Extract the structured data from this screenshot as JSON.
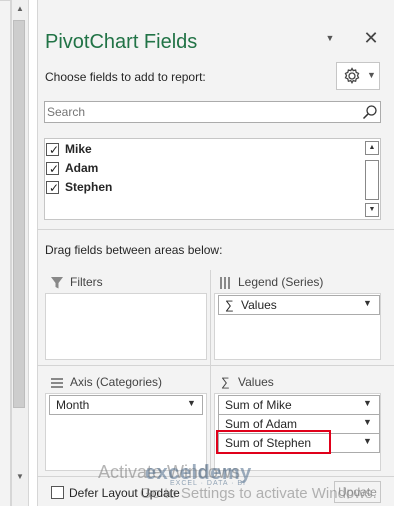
{
  "pane": {
    "title": "PivotChart Fields",
    "choose_label": "Choose fields to add to report:",
    "search_placeholder": "Search",
    "drag_label": "Drag fields between areas below:",
    "defer_label": "Defer Layout Update",
    "update_label": "Update",
    "title_color": "#217346"
  },
  "fields": [
    {
      "label": "Mike",
      "checked": true
    },
    {
      "label": "Adam",
      "checked": true
    },
    {
      "label": "Stephen",
      "checked": true
    }
  ],
  "areas": {
    "filters": {
      "label": "Filters"
    },
    "legend": {
      "label": "Legend (Series)",
      "items": [
        "Values"
      ]
    },
    "axis": {
      "label": "Axis (Categories)",
      "items": [
        "Month"
      ]
    },
    "values": {
      "label": "Values",
      "items": [
        "Sum of Mike",
        "Sum of Adam",
        "Sum of Stephen"
      ],
      "highlighted_item": "Sum of Stephen",
      "highlight_color": "#e0001a"
    }
  },
  "watermark": {
    "activate_text": "Activate Windows",
    "go_text": "Go to Settings to activate Windows."
  },
  "branding": {
    "logo_text": "exceldemy",
    "tagline": "EXCEL · DATA · BI"
  }
}
